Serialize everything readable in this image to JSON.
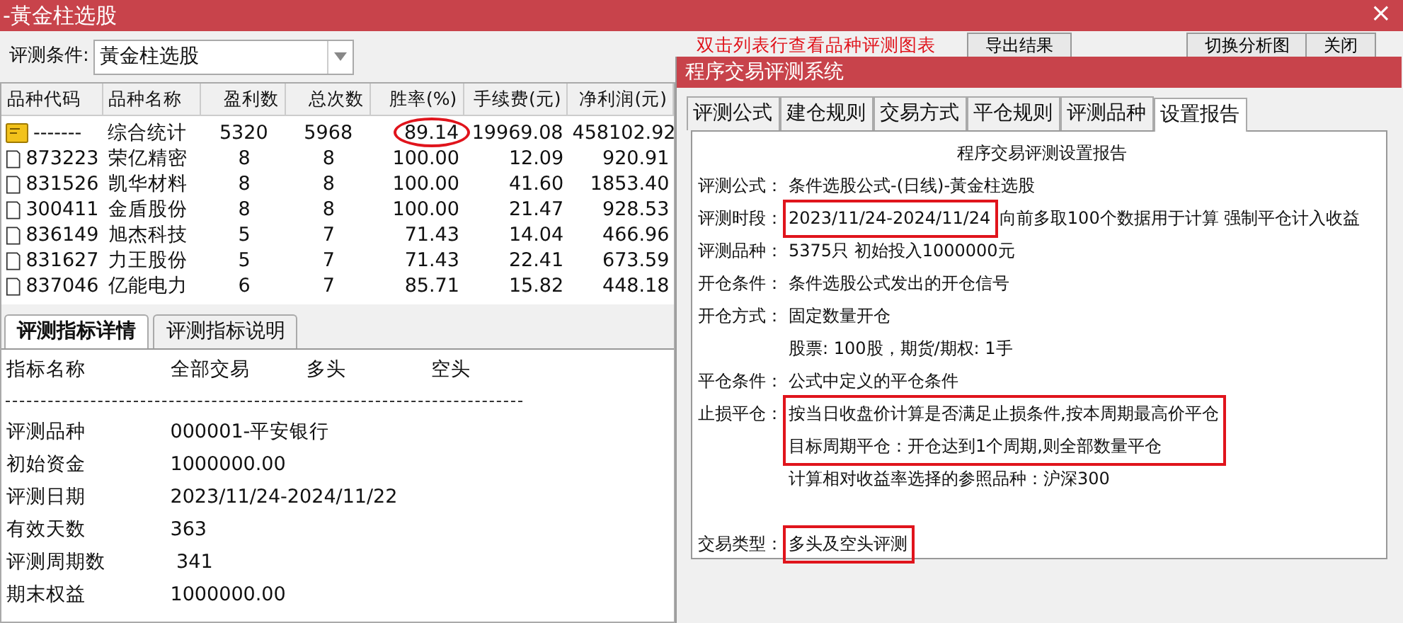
{
  "window": {
    "title": "-黃金柱选股",
    "close": "×"
  },
  "toolbar": {
    "label": "评测条件:",
    "condition": "黃金柱选股",
    "hint": "双击列表行查看品种评测图表",
    "buttons": [
      "导出结果",
      "切换分析图",
      "关闭"
    ]
  },
  "table": {
    "columns": [
      "品种代码",
      "品种名称",
      "盈利数",
      "总次数",
      "胜率(%)",
      "手续费(元)",
      "净利润(元)"
    ],
    "rows": [
      {
        "kind": "summary",
        "circled": true,
        "cells": [
          "-------",
          "综合统计",
          "5320",
          "5968",
          "89.14",
          "19969.08",
          "458102.92"
        ]
      },
      {
        "kind": "stock",
        "circled": false,
        "cells": [
          "873223",
          "荣亿精密",
          "8",
          "8",
          "100.00",
          "12.09",
          "920.91"
        ]
      },
      {
        "kind": "stock",
        "circled": false,
        "cells": [
          "831526",
          "凯华材料",
          "8",
          "8",
          "100.00",
          "41.60",
          "1853.40"
        ]
      },
      {
        "kind": "stock",
        "circled": false,
        "cells": [
          "300411",
          "金盾股份",
          "8",
          "8",
          "100.00",
          "21.47",
          "928.53"
        ]
      },
      {
        "kind": "stock",
        "circled": false,
        "cells": [
          "836149",
          "旭杰科技",
          "5",
          "7",
          "71.43",
          "14.04",
          "466.96"
        ]
      },
      {
        "kind": "stock",
        "circled": false,
        "cells": [
          "831627",
          "力王股份",
          "5",
          "7",
          "71.43",
          "22.41",
          "673.59"
        ]
      },
      {
        "kind": "stock",
        "circled": false,
        "cells": [
          "837046",
          "亿能电力",
          "6",
          "7",
          "85.71",
          "15.82",
          "448.18"
        ]
      }
    ]
  },
  "detail_tabs": [
    {
      "label": "评测指标详情",
      "selected": true
    },
    {
      "label": "评测指标说明",
      "selected": false
    }
  ],
  "details": {
    "header": [
      "指标名称",
      "全部交易",
      "多头",
      "空头"
    ],
    "rows": [
      [
        "评测品种",
        "000001-平安银行"
      ],
      [
        "初始资金",
        "1000000.00"
      ],
      [
        "评测日期",
        "2023/11/24-2024/11/22"
      ],
      [
        "有效天数",
        "363"
      ],
      [
        "评测周期数",
        " 341"
      ],
      [
        "期末权益",
        "1000000.00"
      ]
    ]
  },
  "dialog": {
    "title": "程序交易评测系统",
    "tabs": [
      {
        "label": "评测公式",
        "selected": false
      },
      {
        "label": "建仓规则",
        "selected": false
      },
      {
        "label": "交易方式",
        "selected": false
      },
      {
        "label": "平仓规则",
        "selected": false
      },
      {
        "label": "评测品种",
        "selected": false
      },
      {
        "label": "设置报告",
        "selected": true
      }
    ],
    "report_title": "程序交易评测设置报告",
    "report": [
      {
        "label": "评测公式：",
        "lines": [
          "条件选股公式-(日线)-黃金柱选股"
        ],
        "highlighted": false
      },
      {
        "label": "评测时段：",
        "lines": [
          "2023/11/24-2024/11/24"
        ],
        "highlighted": true,
        "note": "向前多取100个数据用于计算 强制平仓计入收益"
      },
      {
        "label": "评测品种：",
        "lines": [
          "5375只 初始投入1000000元"
        ],
        "highlighted": false
      },
      {
        "label": "开仓条件：",
        "lines": [
          "条件选股公式发出的开仓信号"
        ],
        "highlighted": false
      },
      {
        "label": "开仓方式：",
        "lines": [
          "固定数量开仓",
          "股票: 100股，期货/期权: 1手"
        ],
        "highlighted": false
      },
      {
        "label": "平仓条件：",
        "lines": [
          "公式中定义的平仓条件"
        ],
        "highlighted": false
      },
      {
        "label": "止损平仓：",
        "lines": [
          "按当日收盘价计算是否满足止损条件,按本周期最高价平仓",
          "目标周期平仓：开仓达到1个周期,则全部数量平仓"
        ],
        "highlighted": true
      },
      {
        "lines": [
          "计算相对收益率选择的参照品种：沪深300"
        ],
        "highlighted": false
      },
      {
        "label": "交易类型：",
        "lines": [
          "多头及空头评测"
        ],
        "highlighted": true,
        "gap": true
      }
    ]
  }
}
